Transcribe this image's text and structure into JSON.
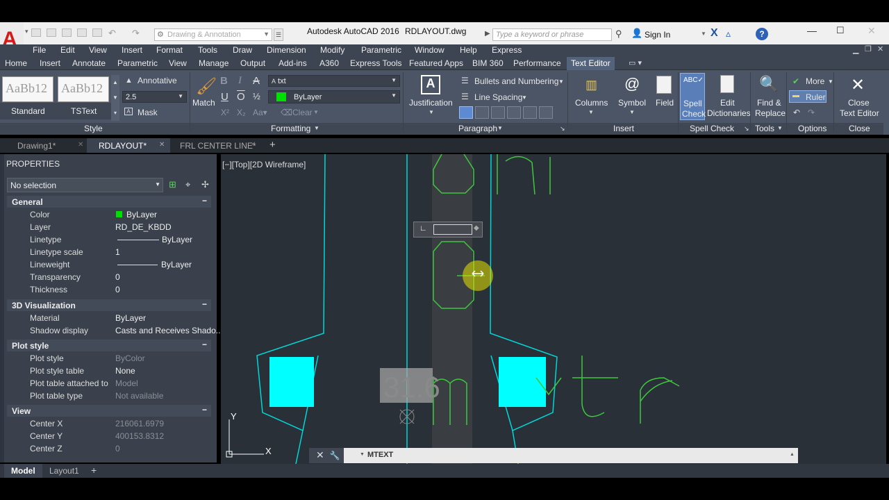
{
  "window": {
    "app_title": "Autodesk AutoCAD 2016",
    "file_title": "RDLAYOUT.dwg",
    "workspace": "Drawing & Annotation",
    "search_placeholder": "Type a keyword or phrase",
    "sign_in": "Sign In"
  },
  "menubar": [
    "File",
    "Edit",
    "View",
    "Insert",
    "Format",
    "Tools",
    "Draw",
    "Dimension",
    "Modify",
    "Parametric",
    "Window",
    "Help",
    "Express"
  ],
  "ribbon_tabs": [
    "Home",
    "Insert",
    "Annotate",
    "Parametric",
    "View",
    "Manage",
    "Output",
    "Add-ins",
    "A360",
    "Express Tools",
    "Featured Apps",
    "BIM 360",
    "Performance",
    "Text Editor"
  ],
  "ribbon": {
    "style": {
      "preview1": "AaBb12",
      "preview2": "AaBb12",
      "label1": "Standard",
      "label2": "TSText",
      "annotative": "Annotative",
      "height": "2.5",
      "mask": "Mask",
      "panel": "Style"
    },
    "formatting": {
      "match": "Match",
      "font": "txt",
      "color": "ByLayer",
      "clear": "Clear",
      "panel": "Formatting"
    },
    "paragraph": {
      "justification": "Justification",
      "bullets": "Bullets and Numbering",
      "line_spacing": "Line Spacing",
      "panel": "Paragraph"
    },
    "insert": {
      "columns": "Columns",
      "symbol": "Symbol",
      "field": "Field",
      "panel": "Insert"
    },
    "spell": {
      "spell_check_1": "Spell",
      "spell_check_2": "Check",
      "edit_dict_1": "Edit",
      "edit_dict_2": "Dictionaries",
      "panel": "Spell Check"
    },
    "tools": {
      "find_1": "Find &",
      "find_2": "Replace",
      "panel": "Tools"
    },
    "options": {
      "more": "More",
      "ruler": "Ruler",
      "panel": "Options"
    },
    "close": {
      "label_1": "Close",
      "label_2": "Text Editor",
      "panel": "Close"
    }
  },
  "doc_tabs": [
    "Drawing1*",
    "RDLAYOUT*",
    "FRL CENTER LINE*"
  ],
  "properties": {
    "title": "PROPERTIES",
    "selection": "No selection",
    "general": {
      "header": "General",
      "rows": [
        {
          "name": "Color",
          "value": "ByLayer"
        },
        {
          "name": "Layer",
          "value": "RD_DE_KBDD"
        },
        {
          "name": "Linetype",
          "value": "ByLayer"
        },
        {
          "name": "Linetype scale",
          "value": "1"
        },
        {
          "name": "Lineweight",
          "value": "ByLayer"
        },
        {
          "name": "Transparency",
          "value": "0"
        },
        {
          "name": "Thickness",
          "value": "0"
        }
      ]
    },
    "viz": {
      "header": "3D Visualization",
      "rows": [
        {
          "name": "Material",
          "value": "ByLayer"
        },
        {
          "name": "Shadow display",
          "value": "Casts  and  Receives  Shado..."
        }
      ]
    },
    "plot": {
      "header": "Plot style",
      "rows": [
        {
          "name": "Plot style",
          "value": "ByColor"
        },
        {
          "name": "Plot style table",
          "value": "None"
        },
        {
          "name": "Plot table attached to",
          "value": "Model"
        },
        {
          "name": "Plot table type",
          "value": "Not available"
        }
      ]
    },
    "view": {
      "header": "View",
      "rows": [
        {
          "name": "Center X",
          "value": "216061.6979"
        },
        {
          "name": "Center Y",
          "value": "400153.8312"
        },
        {
          "name": "Center Z",
          "value": "0"
        }
      ]
    }
  },
  "viewport": {
    "label": "[−][Top][2D Wireframe]",
    "ghost_text": "31.6"
  },
  "command": {
    "text": "MTEXT"
  },
  "status_tabs": [
    "Model",
    "Layout1"
  ],
  "colors": {
    "accent_cyan": "#00ffff",
    "green_text": "#3ec83e",
    "bylayer_green": "#00e000",
    "canvas": "#2a3038"
  }
}
